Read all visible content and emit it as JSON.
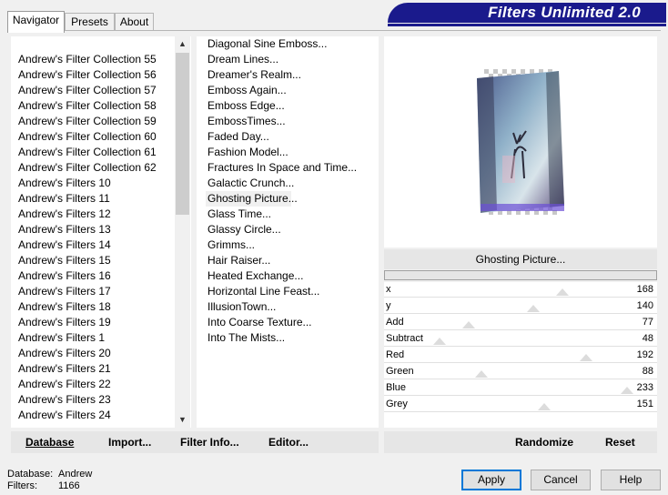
{
  "banner": {
    "title": "Filters Unlimited 2.0"
  },
  "tabs": [
    {
      "label": "Navigator"
    },
    {
      "label": "Presets"
    },
    {
      "label": "About"
    }
  ],
  "categories": [
    "Andrew's Filter Collection 55",
    "Andrew's Filter Collection 56",
    "Andrew's Filter Collection 57",
    "Andrew's Filter Collection 58",
    "Andrew's Filter Collection 59",
    "Andrew's Filter Collection 60",
    "Andrew's Filter Collection 61",
    "Andrew's Filter Collection 62",
    "Andrew's Filters 10",
    "Andrew's Filters 11",
    "Andrew's Filters 12",
    "Andrew's Filters 13",
    "Andrew's Filters 14",
    "Andrew's Filters 15",
    "Andrew's Filters 16",
    "Andrew's Filters 17",
    "Andrew's Filters 18",
    "Andrew's Filters 19",
    "Andrew's Filters 1",
    "Andrew's Filters 20",
    "Andrew's Filters 21",
    "Andrew's Filters 22",
    "Andrew's Filters 23",
    "Andrew's Filters 24"
  ],
  "filters": [
    "Diagonal Sine Emboss...",
    "Dream Lines...",
    "Dreamer's Realm...",
    "Emboss Again...",
    "Emboss Edge...",
    "EmbossTimes...",
    "Faded Day...",
    "Fashion Model...",
    "Fractures In Space and Time...",
    "Galactic Crunch...",
    "Ghosting Picture...",
    "Glass Time...",
    "Glassy Circle...",
    "Grimms...",
    "Hair Raiser...",
    "Heated Exchange...",
    "Horizontal Line Feast...",
    "IllusionTown...",
    "Into Coarse Texture...",
    "Into The Mists..."
  ],
  "selected_filter_index": 10,
  "preview": {
    "filter_name": "Ghosting Picture..."
  },
  "params": [
    {
      "name": "x",
      "value": "168",
      "level": 0.66
    },
    {
      "name": "y",
      "value": "140",
      "level": 0.55
    },
    {
      "name": "Add",
      "value": "77",
      "level": 0.3
    },
    {
      "name": "Subtract",
      "value": "48",
      "level": 0.19
    },
    {
      "name": "Red",
      "value": "192",
      "level": 0.75
    },
    {
      "name": "Green",
      "value": "88",
      "level": 0.35
    },
    {
      "name": "Blue",
      "value": "233",
      "level": 0.91
    },
    {
      "name": "Grey",
      "value": "151",
      "level": 0.59
    }
  ],
  "bottom_left": {
    "database": "Database",
    "import": "Import...",
    "filter_info": "Filter Info...",
    "editor": "Editor..."
  },
  "bottom_right": {
    "randomize": "Randomize",
    "reset": "Reset"
  },
  "status": {
    "database_label": "Database:",
    "database_value": "Andrew",
    "filters_label": "Filters:",
    "filters_value": "1166"
  },
  "buttons": {
    "apply": "Apply",
    "cancel": "Cancel",
    "help": "Help"
  },
  "icons": {
    "scroll_up": "chevron-up-icon",
    "scroll_down": "chevron-down-icon"
  }
}
